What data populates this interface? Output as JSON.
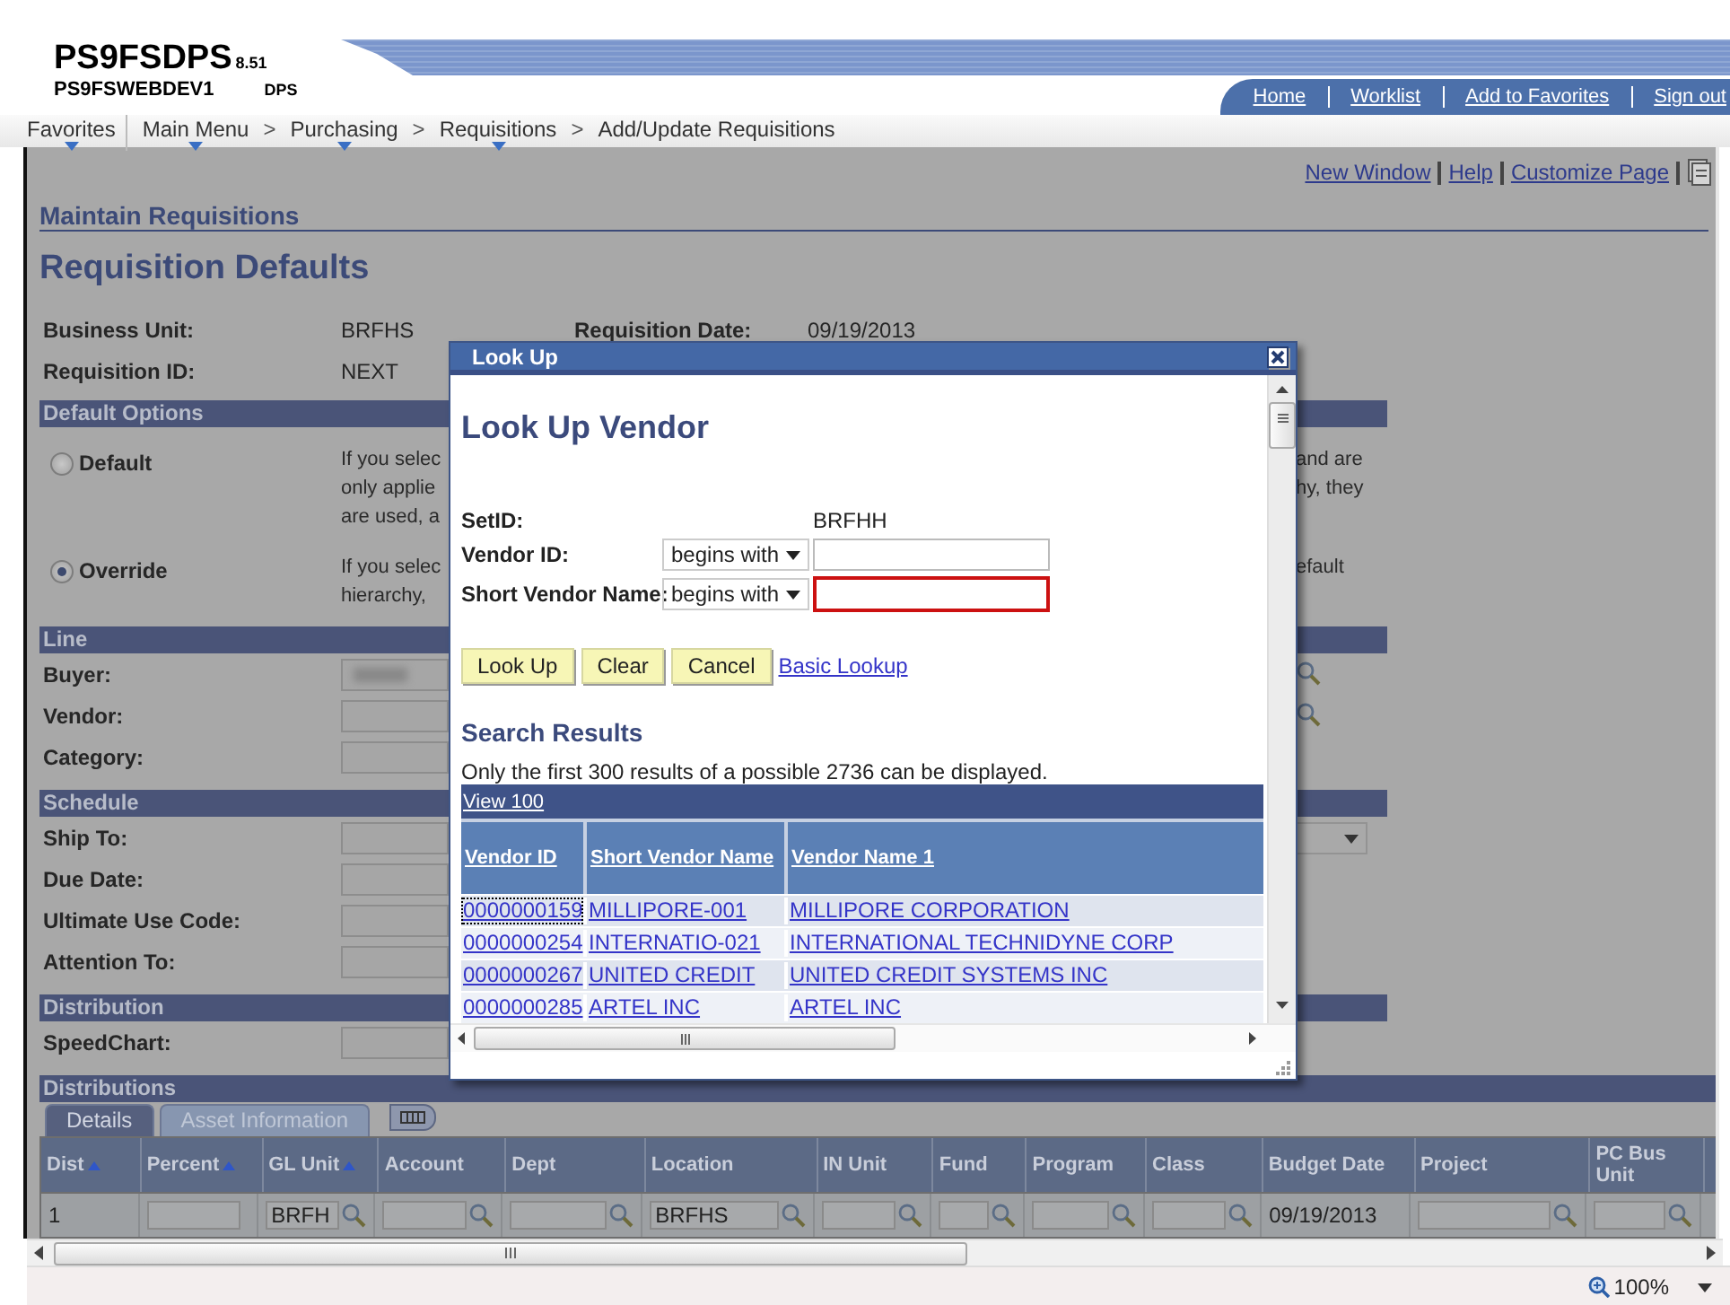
{
  "header": {
    "app_name": "PS9FSDPS",
    "version": "8.51",
    "server": "PS9FSWEBDEV1",
    "database": "DPS",
    "links": [
      "Home",
      "Worklist",
      "Add to Favorites",
      "Sign out"
    ]
  },
  "breadcrumb": {
    "separator": ">",
    "items": [
      {
        "label": "Favorites",
        "menu": true
      },
      {
        "label": "Main Menu",
        "menu": true
      },
      {
        "label": "Purchasing",
        "menu": true
      },
      {
        "label": "Requisitions",
        "menu": true
      },
      {
        "label": "Add/Update Requisitions",
        "menu": false
      }
    ]
  },
  "page_links": [
    "New Window",
    "Help",
    "Customize Page"
  ],
  "component_title": "Maintain Requisitions",
  "page_title": "Requisition Defaults",
  "header_fields": [
    {
      "label": "Business Unit:",
      "value": "BRFHS"
    },
    {
      "label": "Requisition ID:",
      "value": "NEXT"
    }
  ],
  "requisition_date": {
    "label": "Requisition Date:",
    "value": "09/19/2013"
  },
  "sections": [
    {
      "title": "Default Options",
      "rows": [
        {
          "kind": "radio",
          "label": "Default",
          "selected": false,
          "left_text": [
            "If you selec",
            "only applie",
            "are used, a"
          ],
          "right_text": [
            "and are",
            "hy, they"
          ]
        },
        {
          "kind": "radio",
          "label": "Override",
          "selected": true,
          "left_text": [
            "If you selec",
            "hierarchy,"
          ],
          "right_text": [
            "efault"
          ]
        }
      ]
    },
    {
      "title": "Line",
      "rows": [
        {
          "kind": "field",
          "label": "Buyer:",
          "masked": true,
          "lookup": true,
          "dropdown": false
        },
        {
          "kind": "field",
          "label": "Vendor:",
          "masked": false,
          "lookup": true,
          "dropdown": false
        },
        {
          "kind": "field",
          "label": "Category:",
          "masked": false,
          "lookup": false,
          "dropdown": false
        }
      ]
    },
    {
      "title": "Schedule",
      "rows": [
        {
          "kind": "field",
          "label": "Ship To:",
          "masked": false,
          "lookup": false,
          "dropdown": true
        },
        {
          "kind": "field",
          "label": "Due Date:",
          "masked": false,
          "lookup": false,
          "dropdown": false
        },
        {
          "kind": "field",
          "label": "Ultimate Use Code:",
          "masked": false,
          "lookup": false,
          "dropdown": false
        },
        {
          "kind": "field",
          "label": "Attention To:",
          "masked": false,
          "lookup": false,
          "dropdown": false
        }
      ]
    },
    {
      "title": "Distribution",
      "rows": [
        {
          "kind": "field",
          "label": "SpeedChart:",
          "masked": false,
          "lookup": false,
          "dropdown": false
        }
      ]
    }
  ],
  "distributions": {
    "title": "Distributions",
    "tabs": [
      {
        "label": "Details",
        "selected": true
      },
      {
        "label": "Asset Information",
        "selected": false
      }
    ],
    "columns": [
      {
        "label": "Dist",
        "sortable": true
      },
      {
        "label": "Percent",
        "sortable": true
      },
      {
        "label": "GL Unit",
        "sortable": true
      },
      {
        "label": "Account",
        "sortable": false
      },
      {
        "label": "Dept",
        "sortable": false
      },
      {
        "label": "Location",
        "sortable": false
      },
      {
        "label": "IN Unit",
        "sortable": false
      },
      {
        "label": "Fund",
        "sortable": false
      },
      {
        "label": "Program",
        "sortable": false
      },
      {
        "label": "Class",
        "sortable": false
      },
      {
        "label": "Budget Date",
        "sortable": false
      },
      {
        "label": "Project",
        "sortable": false
      },
      {
        "label": "PC Bus Unit",
        "sortable": false
      }
    ],
    "row": [
      {
        "kind": "text",
        "value": "1"
      },
      {
        "kind": "input"
      },
      {
        "kind": "lookup",
        "value": "BRFH"
      },
      {
        "kind": "lookup"
      },
      {
        "kind": "lookup"
      },
      {
        "kind": "lookup",
        "value": "BRFHS"
      },
      {
        "kind": "lookup"
      },
      {
        "kind": "lookup"
      },
      {
        "kind": "lookup"
      },
      {
        "kind": "lookup"
      },
      {
        "kind": "text",
        "value": "09/19/2013"
      },
      {
        "kind": "lookup"
      },
      {
        "kind": "lookup"
      }
    ]
  },
  "lookup_dialog": {
    "title": "Look Up",
    "heading": "Look Up Vendor",
    "setid": {
      "label": "SetID:",
      "value": "BRFHH"
    },
    "criteria": [
      {
        "label": "Vendor ID:",
        "operator": "begins with",
        "focused": false
      },
      {
        "label": "Short Vendor Name:",
        "operator": "begins with",
        "focused": true
      }
    ],
    "buttons": [
      "Look Up",
      "Clear",
      "Cancel"
    ],
    "basic_lookup": "Basic Lookup",
    "results_title": "Search Results",
    "results_note": "Only the first 300 results of a possible 2736 can be displayed.",
    "view_link": "View 100",
    "columns": [
      "Vendor ID",
      "Short Vendor Name",
      "Vendor Name 1"
    ],
    "rows": [
      {
        "cells": [
          "0000000159",
          "MILLIPORE-001",
          "MILLIPORE CORPORATION"
        ],
        "focused": true
      },
      {
        "cells": [
          "0000000254",
          "INTERNATIO-021",
          "INTERNATIONAL TECHNIDYNE CORP"
        ],
        "focused": false
      },
      {
        "cells": [
          "0000000267",
          "UNITED CREDIT",
          "UNITED CREDIT SYSTEMS INC"
        ],
        "focused": false
      },
      {
        "cells": [
          "0000000285",
          "ARTEL INC",
          "ARTEL INC"
        ],
        "focused": false
      }
    ]
  },
  "status_bar": {
    "zoom": "100%"
  }
}
